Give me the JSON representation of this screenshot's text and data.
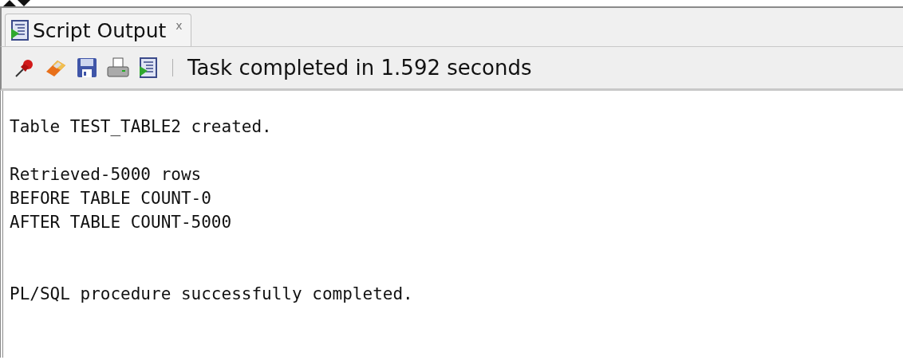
{
  "tab": {
    "label": "Script Output",
    "close": "x",
    "selected": true
  },
  "toolbar": {
    "status": "Task completed in 1.592 seconds"
  },
  "output": [
    {
      "kind": "blank"
    },
    {
      "kind": "text",
      "text": "Table TEST_TABLE2 created."
    },
    {
      "kind": "blank"
    },
    {
      "kind": "text",
      "text": "Retrieved-5000 rows"
    },
    {
      "kind": "text",
      "text": "BEFORE TABLE COUNT-0"
    },
    {
      "kind": "text",
      "text": "AFTER TABLE COUNT-5000"
    },
    {
      "kind": "blank"
    },
    {
      "kind": "blank"
    },
    {
      "kind": "text",
      "text": "PL/SQL procedure successfully completed."
    }
  ]
}
